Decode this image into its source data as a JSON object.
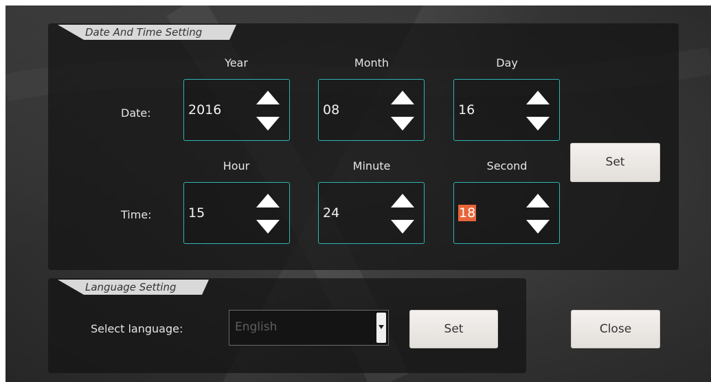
{
  "date_time": {
    "title": "Date And Time Setting",
    "date_label": "Date:",
    "time_label": "Time:",
    "fields": [
      {
        "label": "Year",
        "value": "2016"
      },
      {
        "label": "Month",
        "value": "08"
      },
      {
        "label": "Day",
        "value": "16"
      },
      {
        "label": "Hour",
        "value": "15"
      },
      {
        "label": "Minute",
        "value": "24"
      },
      {
        "label": "Second",
        "value": "18"
      }
    ],
    "set_label": "Set"
  },
  "language": {
    "title": "Language Setting",
    "select_label": "Select language:",
    "selected": "English",
    "set_label": "Set"
  },
  "close_label": "Close",
  "colors": {
    "spinner_border": "#30b5b5",
    "selection_highlight": "#e8643a",
    "panel": "#141414"
  }
}
